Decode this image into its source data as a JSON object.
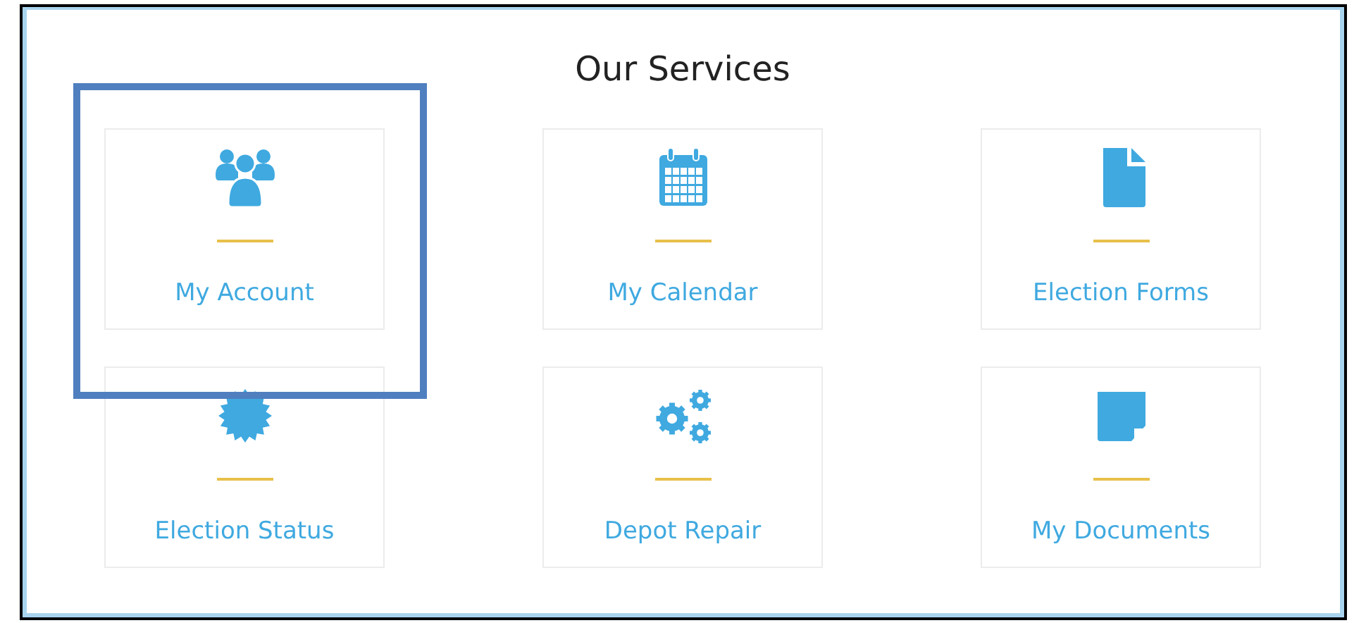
{
  "title": "Our Services",
  "cards": [
    {
      "kind": "users",
      "label": "My Account",
      "selected": true
    },
    {
      "kind": "calendar",
      "label": "My Calendar",
      "selected": false
    },
    {
      "kind": "document",
      "label": "Election Forms",
      "selected": false
    },
    {
      "kind": "badge",
      "label": "Election Status",
      "selected": false
    },
    {
      "kind": "gears",
      "label": "Depot Repair",
      "selected": false
    },
    {
      "kind": "note",
      "label": "My Documents",
      "selected": false
    }
  ]
}
